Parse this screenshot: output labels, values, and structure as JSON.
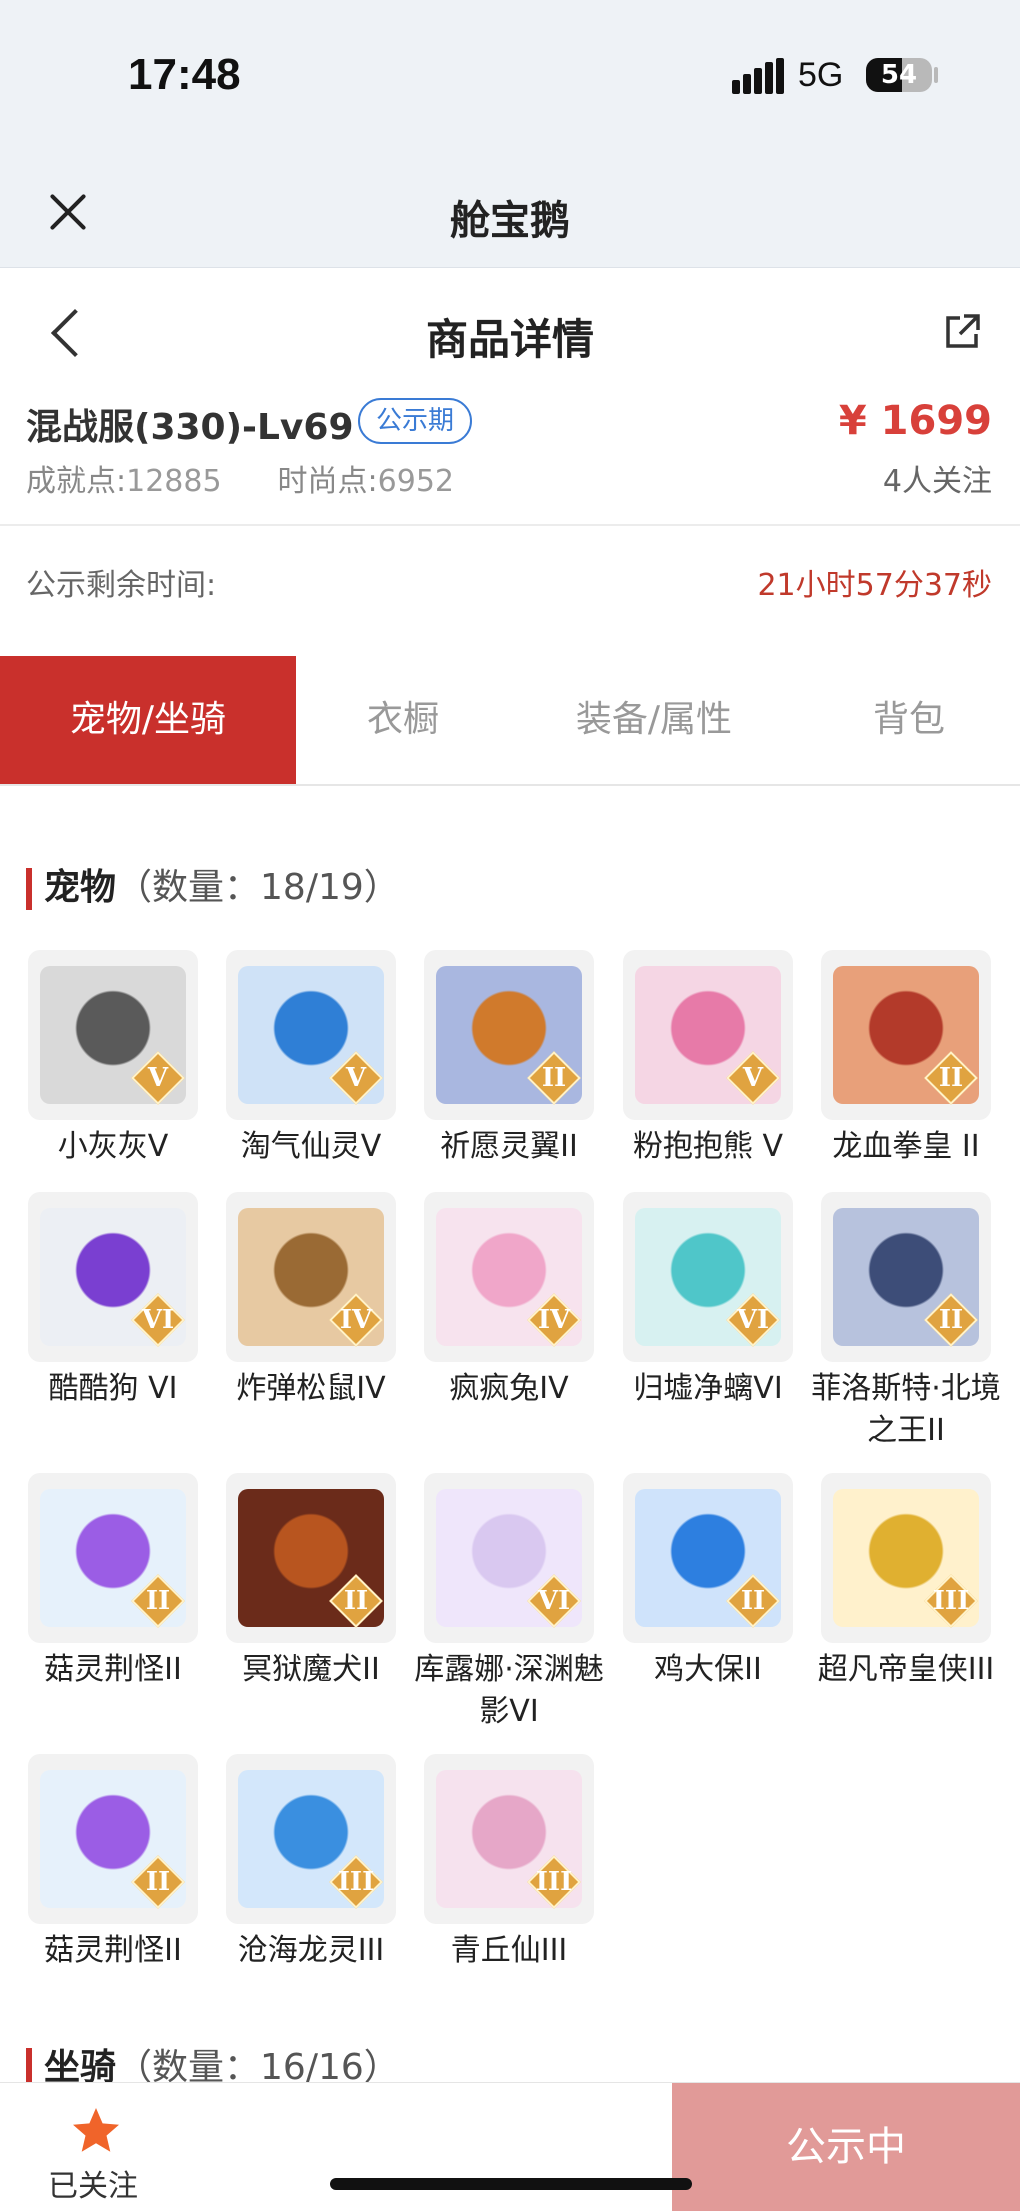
{
  "status_bar": {
    "time": "17:48",
    "network": "5G",
    "battery": "54",
    "battery_level": 0.54
  },
  "app": {
    "title": "舱宝鹅"
  },
  "header": {
    "title": "商品详情"
  },
  "product": {
    "title": "混战服(330)-Lv69",
    "badge": "公示期",
    "price": "¥ 1699",
    "achievement_label": "成就点:",
    "achievement_value": "12885",
    "fashion_label": "时尚点:",
    "fashion_value": "6952",
    "watchers": "4人关注"
  },
  "countdown": {
    "label": "公示剩余时间:",
    "value": "21小时57分37秒"
  },
  "tabs": [
    {
      "label": "宠物/坐骑",
      "active": true
    },
    {
      "label": "衣橱",
      "active": false
    },
    {
      "label": "装备/属性",
      "active": false
    },
    {
      "label": "背包",
      "active": false
    }
  ],
  "pets_section": {
    "title": "宠物",
    "count": "（数量：18/19）"
  },
  "pets": [
    {
      "name": "小灰灰V",
      "rank": "V",
      "color": "#5a5a5a",
      "bg": "#d9d9d9"
    },
    {
      "name": "淘气仙灵V",
      "rank": "V",
      "color": "#2f7fd6",
      "bg": "#cfe2f7"
    },
    {
      "name": "祈愿灵翼II",
      "rank": "II",
      "color": "#d07a2c",
      "bg": "#a9b7e0"
    },
    {
      "name": "粉抱抱熊 V",
      "rank": "V",
      "color": "#e77aa8",
      "bg": "#f5d6e4"
    },
    {
      "name": "龙血拳皇 II",
      "rank": "II",
      "color": "#b33a2a",
      "bg": "#e8a07a"
    },
    {
      "name": "酷酷狗 VI",
      "rank": "VI",
      "color": "#7a3fd1",
      "bg": "#eceff4"
    },
    {
      "name": "炸弹松鼠IV",
      "rank": "IV",
      "color": "#9a6a34",
      "bg": "#e7c9a2"
    },
    {
      "name": "疯疯兔IV",
      "rank": "IV",
      "color": "#f0a6c9",
      "bg": "#f7e3ee"
    },
    {
      "name": "归墟净螭VI",
      "rank": "VI",
      "color": "#4fc6c9",
      "bg": "#d7f1f1"
    },
    {
      "name": "菲洛斯特·北境之王II",
      "rank": "II",
      "color": "#3d4d78",
      "bg": "#b7c2dd"
    },
    {
      "name": "菇灵荆怪II",
      "rank": "II",
      "color": "#9b5de5",
      "bg": "#e6f1fb"
    },
    {
      "name": "冥狱魔犬II",
      "rank": "II",
      "color": "#b8551f",
      "bg": "#6b2b1a"
    },
    {
      "name": "库露娜·深渊魅影VI",
      "rank": "VI",
      "color": "#d9c8f0",
      "bg": "#efe6fb"
    },
    {
      "name": "鸡大保II",
      "rank": "II",
      "color": "#2d7fe0",
      "bg": "#cfe3fb"
    },
    {
      "name": "超凡帝皇侠III",
      "rank": "III",
      "color": "#e0b030",
      "bg": "#fff1cc"
    },
    {
      "name": "菇灵荆怪II",
      "rank": "II",
      "color": "#9b5de5",
      "bg": "#e6f1fb"
    },
    {
      "name": "沧海龙灵III",
      "rank": "III",
      "color": "#3a8fe0",
      "bg": "#d3e7fb"
    },
    {
      "name": "青丘仙III",
      "rank": "III",
      "color": "#e6a7c8",
      "bg": "#f6e2ee"
    }
  ],
  "mounts_section": {
    "title": "坐骑",
    "count": "（数量：16/16）"
  },
  "bottom": {
    "follow_label": "已关注",
    "status_label": "公示中"
  },
  "colors": {
    "accent": "#c9302c",
    "price": "#d8403a",
    "badge": "#3a7bd5",
    "status_button": "#e19a98",
    "star": "#f0642a"
  },
  "icons": {
    "close": "close-icon",
    "back": "back-arrow-icon",
    "share": "share-icon",
    "follow": "star-icon",
    "rank": "rank-diamond-icon"
  }
}
